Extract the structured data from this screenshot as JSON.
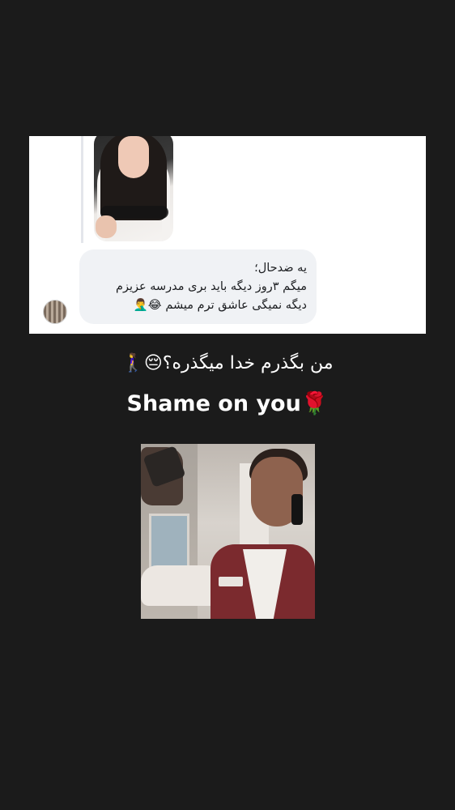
{
  "message": {
    "lines": [
      "یه ضدحال؛",
      "میگم ۳روز دیگه باید بری مدرسه عزیزم",
      "دیگه نمیگی عاشق ترم میشم 😂🤦‍♂️"
    ],
    "bubble_color": "#f0f2f5",
    "text_color": "#1c1e21"
  },
  "reply_preview": {
    "icon": "photo-thumbnail"
  },
  "avatar": {
    "icon": "avatar-icon"
  },
  "story": {
    "line_farsi": "من بگذرم خدا میگذره؟😔🚶‍♀️",
    "line_english": "Shame on you🌹",
    "background": "#1b1b1b",
    "text_color": "#ffffff"
  },
  "meme": {
    "icon": "meme-photo"
  }
}
